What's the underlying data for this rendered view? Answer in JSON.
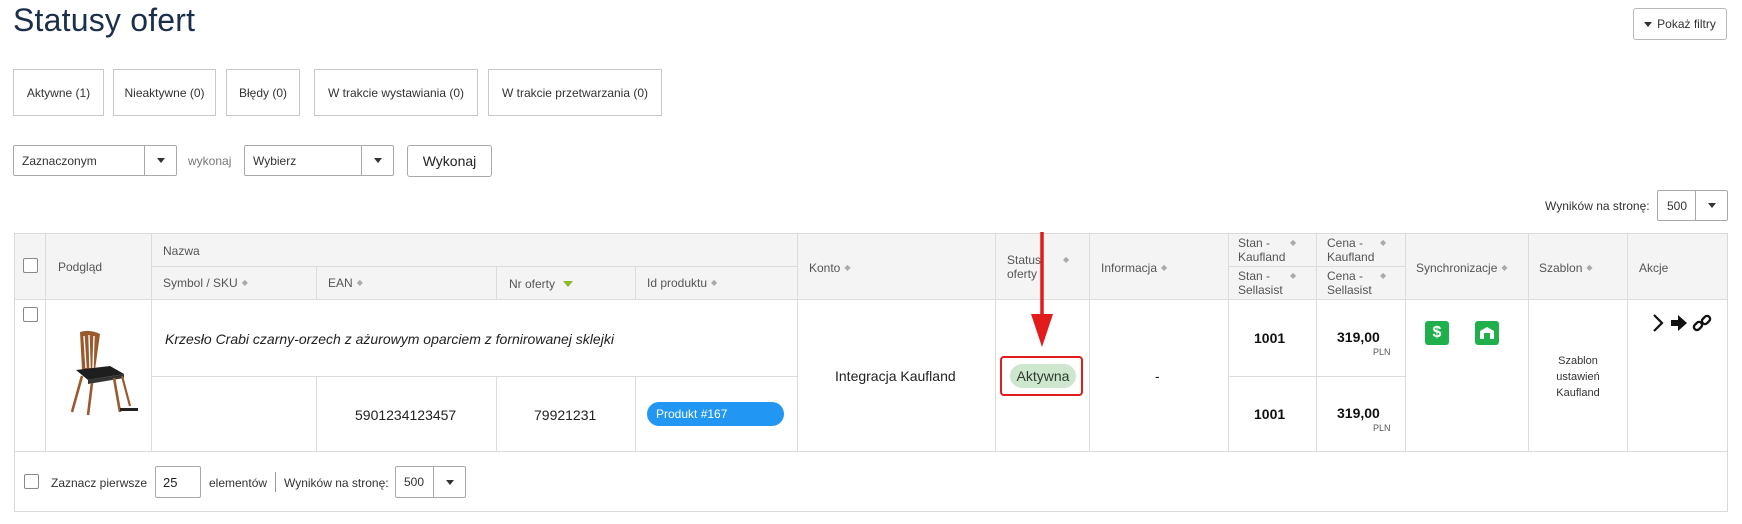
{
  "page": {
    "title": "Statusy ofert",
    "show_filters_label": "Pokaż filtry"
  },
  "status_tabs": [
    {
      "label": "Aktywne (1)"
    },
    {
      "label": "Nieaktywne (0)"
    },
    {
      "label": "Błędy (0)"
    },
    {
      "label": "W trakcie wystawiania (0)"
    },
    {
      "label": "W trakcie przetwarzania (0)"
    }
  ],
  "bulk_actions": {
    "scope_value": "Zaznaczonym",
    "execute_label": "wykonaj",
    "action_value": "Wybierz",
    "execute_button": "Wykonaj"
  },
  "pagination_top": {
    "label": "Wyników na stronę:",
    "value": "500"
  },
  "table": {
    "headers": {
      "preview": "Podgląd",
      "name": "Nazwa",
      "sku": "Symbol / SKU",
      "ean": "EAN",
      "offer_no": "Nr oferty",
      "product_id": "Id produktu",
      "account": "Konto",
      "status": "Status oferty",
      "info": "Informacja",
      "stock_kaufland": "Stan - Kaufland",
      "stock_sellasist": "Stan - Sellasist",
      "price_kaufland": "Cena - Kaufland",
      "price_sellasist": "Cena - Sellasist",
      "sync": "Synchronizacje",
      "template": "Szablon",
      "actions": "Akcje"
    },
    "row": {
      "name": "Krzesło Crabi czarny-orzech z ażurowym oparciem z fornirowanej sklejki",
      "sku": "",
      "ean": "5901234123457",
      "offer_no": "79921231",
      "product_badge": "Produkt #167",
      "account": "Integracja Kaufland",
      "status": "Aktywna",
      "info": "-",
      "stock_kaufland": "1001",
      "stock_sellasist": "1001",
      "price_kaufland": "319,00",
      "price_sellasist": "319,00",
      "currency": "PLN",
      "template_lines": [
        "Szablon",
        "ustawień",
        "Kaufland"
      ],
      "sync_icons": [
        "dollar-icon",
        "warehouse-icon"
      ],
      "action_icons": [
        "chevron-right-icon",
        "arrow-right-icon",
        "link-icon"
      ]
    }
  },
  "footer": {
    "select_first_label": "Zaznacz pierwsze",
    "select_first_value": "25",
    "elements_label": "elementów",
    "per_page_label": "Wyników na stronę:",
    "per_page_value": "500"
  },
  "colors": {
    "title": "#1c2f4a",
    "status_badge_bg": "#cde6cd",
    "product_badge_bg": "#2196f3",
    "sync_icon_bg": "#1fb04b",
    "highlight": "#e01c1c",
    "sort_active": "#8cb82a"
  }
}
